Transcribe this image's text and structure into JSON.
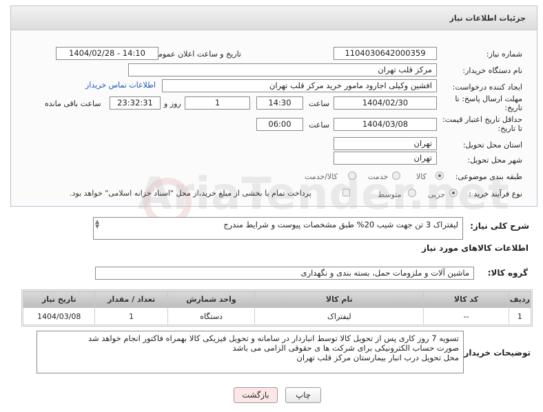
{
  "header": {
    "title": "جزئیات اطلاعات نیاز"
  },
  "fields": {
    "need_number_label": "شماره نیاز:",
    "need_number": "1104030642000359",
    "announce_label": "تاریخ و ساعت اعلان عمومی:",
    "announce_value": "1404/02/28 - 14:10",
    "buyer_org_label": "نام دستگاه خریدار:",
    "buyer_org": "مرکز قلب تهران",
    "creator_label": "ایجاد کننده درخواست:",
    "creator": "افشین وکیلی اجارود مامور خرید مرکز قلب تهران",
    "contact_link": "اطلاعات تماس خریدار",
    "deadline_label": "مهلت ارسال پاسخ: تا تاریخ:",
    "deadline_date": "1404/02/30",
    "time_label": "ساعت",
    "deadline_time": "14:30",
    "days_value": "1",
    "days_label": "روز و",
    "remaining_value": "23:32:31",
    "remaining_label": "ساعت باقی مانده",
    "validity_label": "حداقل تاریخ اعتبار قیمت: تا تاریخ:",
    "validity_date": "1404/03/08",
    "validity_time_label": "ساعت",
    "validity_time": "06:00",
    "province_label": "استان محل تحویل:",
    "province": "تهران",
    "city_label": "شهر محل تحویل:",
    "city": "تهران",
    "category_label": "طبقه بندی موضوعی:",
    "category_options": [
      "کالا",
      "خدمت",
      "کالا/خدمت"
    ],
    "process_label": "نوع فرآیند خرید :",
    "process_options": [
      "جزیی",
      "متوسط"
    ],
    "payment_note": "پرداخت تمام یا بخشی از مبلغ خرید،از محل \"اسناد خزانه اسلامی\" خواهد بود."
  },
  "description": {
    "label": "شرح کلی نیاز:",
    "value": "لیفتراک 3 تن جهت شیب 20% طبق مشخصات پیوست و شرایط مندرج"
  },
  "goods": {
    "section_title": "اطلاعات کالاهای مورد نیاز",
    "group_label": "گروه کالا:",
    "group_value": "ماشین آلات و ملزومات حمل، بسته بندی و نگهداری"
  },
  "table": {
    "headers": [
      "ردیف",
      "کد کالا",
      "نام کالا",
      "واحد شمارش",
      "تعداد / مقدار",
      "تاریخ نیاز"
    ],
    "rows": [
      [
        "1",
        "--",
        "لیفتراک",
        "دستگاه",
        "1",
        "1404/03/08"
      ]
    ]
  },
  "buyer_notes": {
    "label": "توضیحات خریدار:",
    "lines": [
      "تسویه 7 روز کاری پس از تحویل  کالا توسط انباردار در سامانه و تحویل فیزیکی کالا بهمراه فاکتور انجام خواهد شد",
      "صورت حساب الکترونیکی برای شرکت ها ی حقوقی الزامی می باشد",
      "محل تحویل درب انبار بیمارستان مرکز قلب تهران"
    ]
  },
  "buttons": {
    "print": "چاپ",
    "back": "بازگشت"
  },
  "watermark": "AriaTender.net",
  "colors": {
    "link": "#1a56b8",
    "back_button_bg": "#fde6e6"
  }
}
